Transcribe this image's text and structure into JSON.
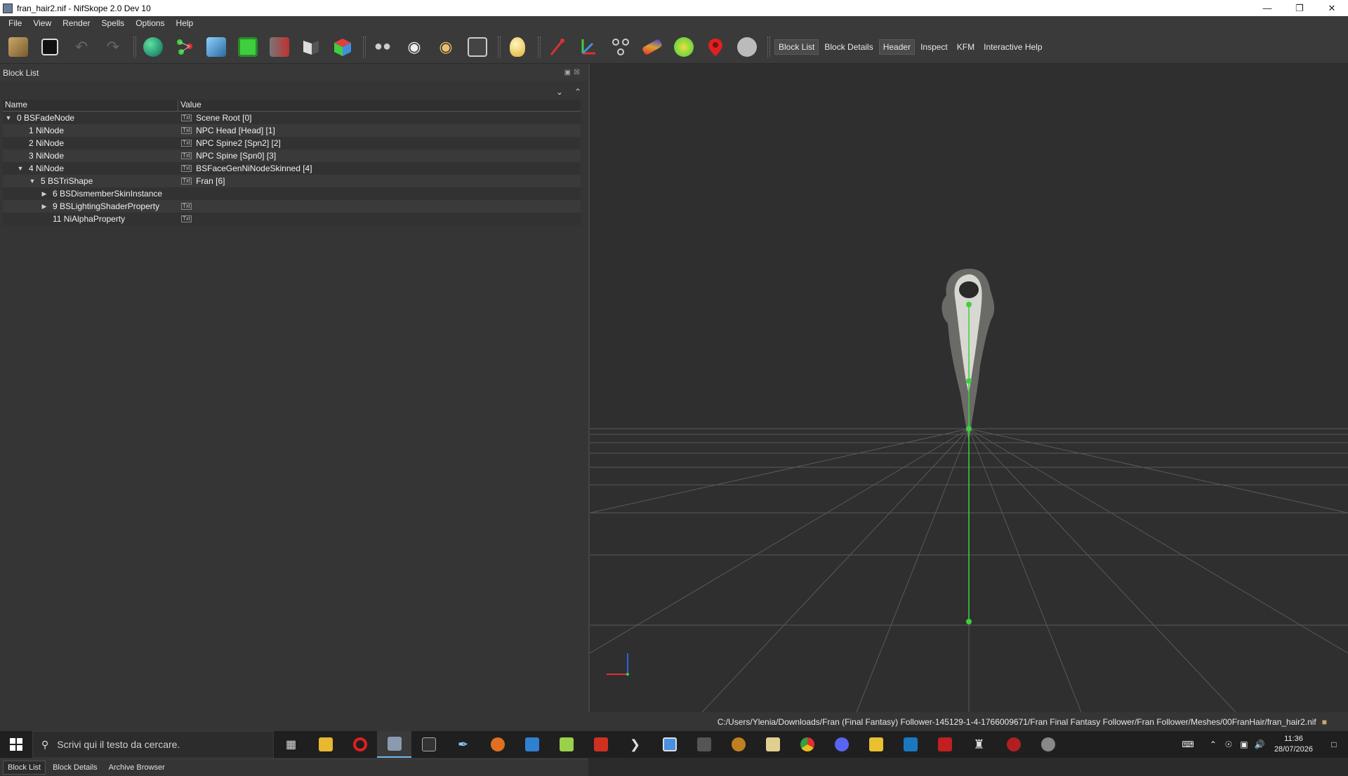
{
  "window": {
    "title": "fran_hair2.nif - NifSkope 2.0 Dev 10",
    "controls": [
      "minimize-icon",
      "restore-icon",
      "close-icon"
    ]
  },
  "menu": [
    "File",
    "View",
    "Render",
    "Spells",
    "Options",
    "Help"
  ],
  "toolbar": {
    "icons": [
      "load-icon",
      "save-icon",
      "undo-icon",
      "redo-icon",
      "select-object-icon",
      "select-vertex-icon",
      "view-front-icon",
      "view-top-icon",
      "view-side-icon",
      "view-flip-icon",
      "view-user-icon",
      "walk-icon",
      "show-icon",
      "hide-icon",
      "screenshot-icon",
      "light-icon",
      "show-axes-icon",
      "show-nodes-icon",
      "show-constraints-icon",
      "show-markers-icon",
      "show-havok-icon",
      "show-furniture-icon",
      "show-hidden-icon"
    ],
    "tabs": [
      {
        "label": "Block List",
        "active": true
      },
      {
        "label": "Block Details",
        "active": false
      },
      {
        "label": "Header",
        "active": true
      },
      {
        "label": "Inspect",
        "active": false
      },
      {
        "label": "KFM",
        "active": false
      },
      {
        "label": "Interactive Help",
        "active": false
      }
    ]
  },
  "block_list": {
    "title": "Block List",
    "columns": [
      "Name",
      "Value"
    ],
    "rows": [
      {
        "name": "0 BSFadeNode",
        "value": "Scene Root [0]",
        "indent": 0,
        "arrow": "down",
        "txt": true
      },
      {
        "name": "1 NiNode",
        "value": "NPC Head [Head] [1]",
        "indent": 1,
        "arrow": "",
        "txt": true
      },
      {
        "name": "2 NiNode",
        "value": "NPC Spine2 [Spn2] [2]",
        "indent": 1,
        "arrow": "",
        "txt": true
      },
      {
        "name": "3 NiNode",
        "value": "NPC Spine [Spn0] [3]",
        "indent": 1,
        "arrow": "",
        "txt": true
      },
      {
        "name": "4 NiNode",
        "value": "BSFaceGenNiNodeSkinned [4]",
        "indent": 1,
        "arrow": "down",
        "txt": true
      },
      {
        "name": "5 BSTriShape",
        "value": "Fran [6]",
        "indent": 2,
        "arrow": "down",
        "txt": true
      },
      {
        "name": "6 BSDismemberSkinInstance",
        "value": "",
        "indent": 3,
        "arrow": "right",
        "txt": false
      },
      {
        "name": "9 BSLightingShaderProperty",
        "value": "",
        "indent": 3,
        "arrow": "right",
        "txt": true
      },
      {
        "name": "11 NiAlphaProperty",
        "value": "",
        "indent": 3,
        "arrow": "",
        "txt": true
      }
    ]
  },
  "bottom_tabs": [
    {
      "label": "Block List",
      "active": true
    },
    {
      "label": "Block Details",
      "active": false
    },
    {
      "label": "Archive Browser",
      "active": false
    }
  ],
  "status": {
    "path": "C:/Users/Ylenia/Downloads/Fran (Final Fantasy) Follower-145129-1-4-1766009671/Fran Final Fantasy Follower/Fran Follower/Meshes/00FranHair/fran_hair2.nif"
  },
  "taskbar": {
    "search_placeholder": "Scrivi qui il testo da cercare.",
    "time": "11:36",
    "date": "28/07/2026"
  },
  "colors": {
    "accent_green": "#3ecf3e",
    "toolbar_bg": "#3a3a3a",
    "viewport_bg": "#2f2f2f"
  }
}
